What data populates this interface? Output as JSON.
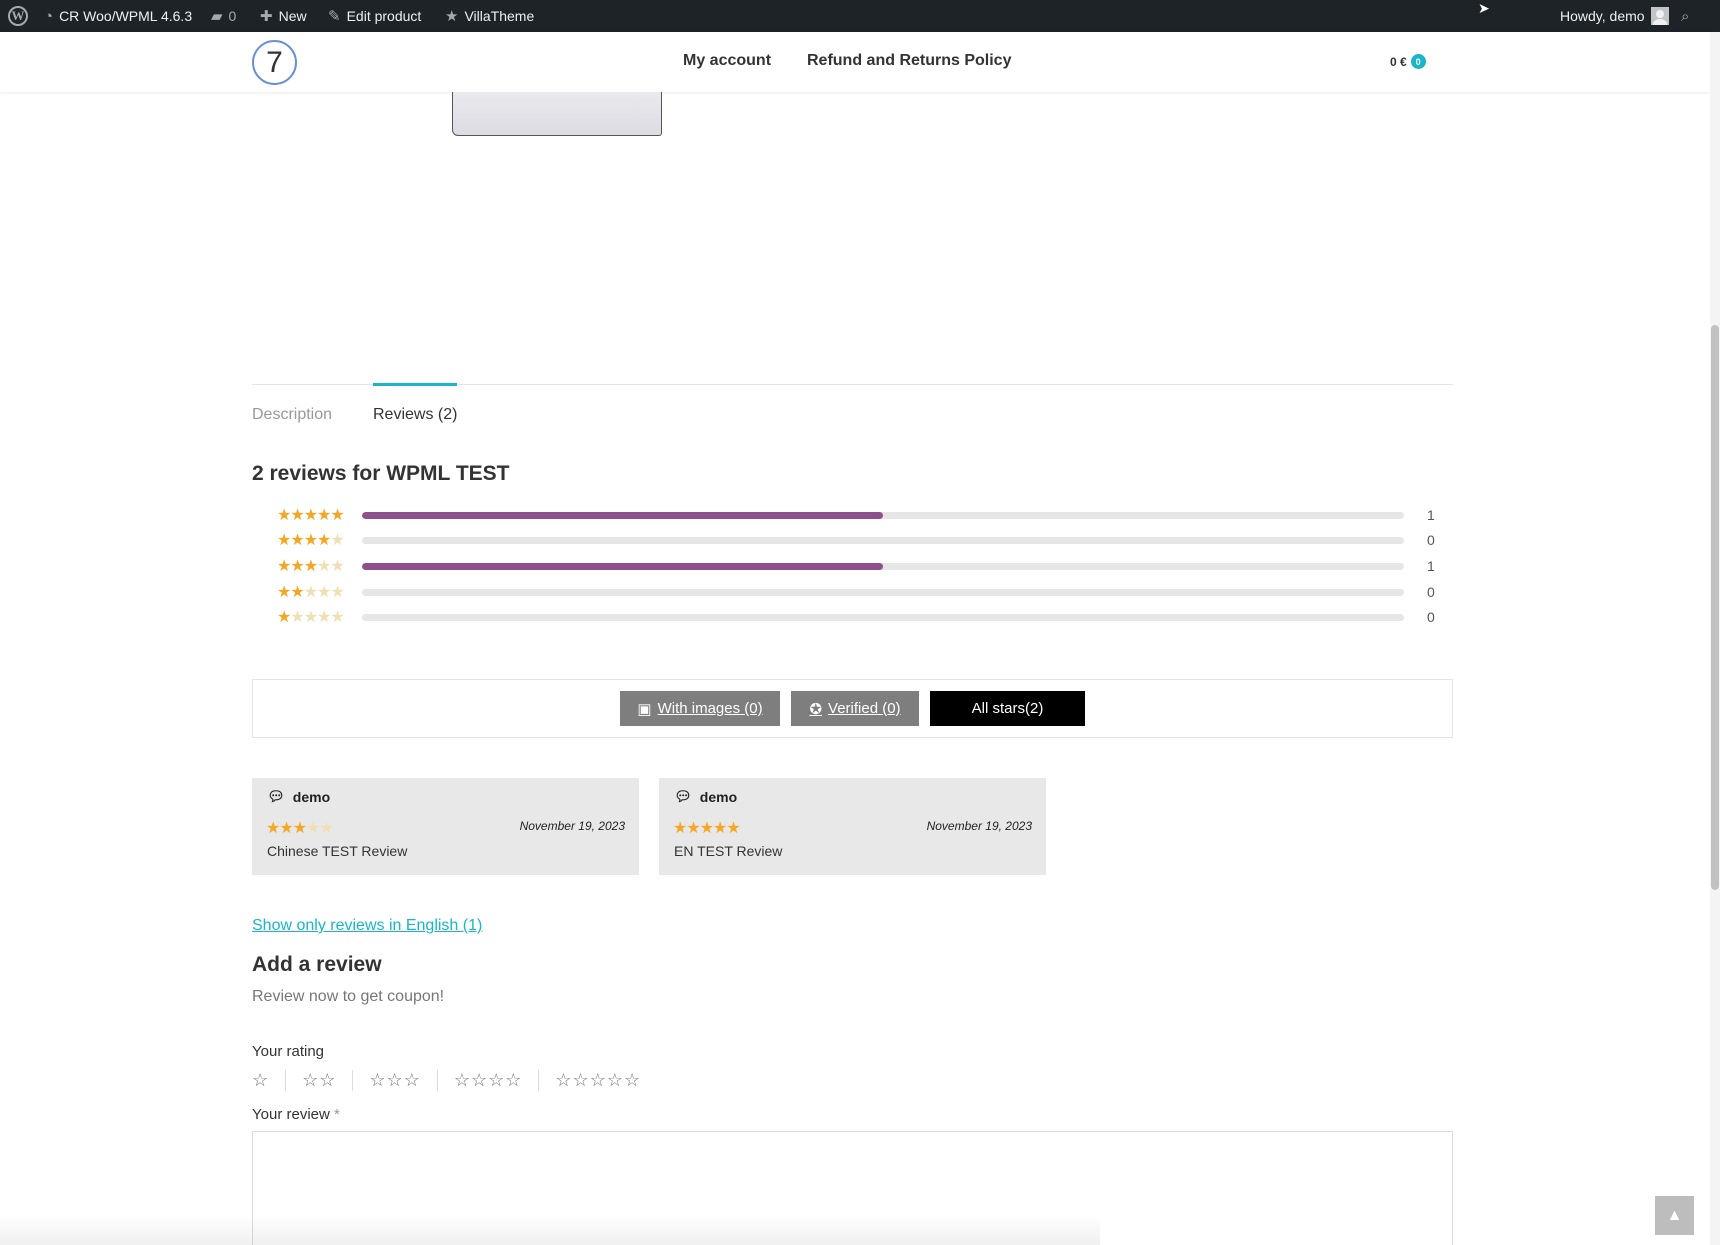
{
  "adminbar": {
    "site_name": "CR Woo/WPML 4.6.3",
    "comments_count": "0",
    "new_label": "New",
    "edit_label": "Edit product",
    "villatheme_label": "VillaTheme",
    "howdy": "Howdy, demo"
  },
  "header": {
    "logo_text": "7",
    "nav": [
      "My account",
      "Refund and Returns Policy"
    ],
    "cart_total": "0 €",
    "cart_count": "0"
  },
  "tabs": {
    "description": "Description",
    "reviews": "Reviews (2)"
  },
  "reviews": {
    "title": "2 reviews for WPML TEST",
    "breakdown": [
      {
        "stars": 5,
        "count": "1",
        "fraction": 0.5
      },
      {
        "stars": 4,
        "count": "0",
        "fraction": 0
      },
      {
        "stars": 3,
        "count": "1",
        "fraction": 0.5
      },
      {
        "stars": 2,
        "count": "0",
        "fraction": 0
      },
      {
        "stars": 1,
        "count": "0",
        "fraction": 0
      }
    ],
    "filters": {
      "with_images": "With images (0)",
      "verified": "Verified (0)",
      "all_stars": "All stars(2)"
    },
    "items": [
      {
        "author": "demo",
        "rating": 3,
        "date": "November 19, 2023",
        "text": "Chinese TEST Review"
      },
      {
        "author": "demo",
        "rating": 5,
        "date": "November 19, 2023",
        "text": "EN TEST Review"
      }
    ],
    "lang_link": "Show only reviews in English (1)"
  },
  "form": {
    "title": "Add a review",
    "note": "Review now to get coupon!",
    "rating_label": "Your rating",
    "review_label": "Your review",
    "required_mark": "*"
  },
  "colors": {
    "accent": "#1ab5c9",
    "bar_fill": "#8e4f8a",
    "star": "#f5a623",
    "adminbar": "#1d2327"
  }
}
